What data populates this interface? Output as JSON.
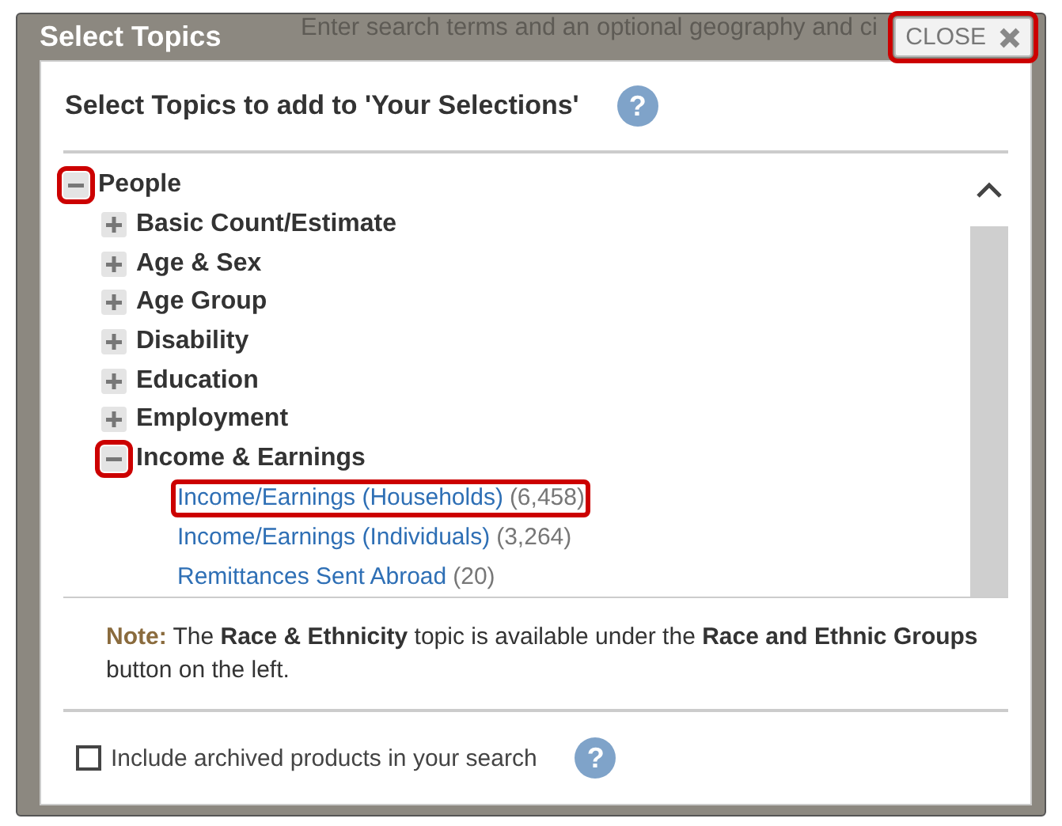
{
  "background": {
    "text": "Enter search terms and an optional geography and ci"
  },
  "dialog": {
    "title": "Select Topics",
    "close": {
      "label": "CLOSE",
      "highlighted": true
    },
    "heading": "Select Topics to add to 'Your Selections'",
    "heading_help": "?",
    "tree": [
      {
        "kind": "group",
        "label": "People",
        "expanded": true,
        "highlighted": true,
        "children": [
          {
            "kind": "group",
            "label": "Basic Count/Estimate",
            "expanded": false,
            "highlighted": false
          },
          {
            "kind": "group",
            "label": "Age & Sex",
            "expanded": false,
            "highlighted": false
          },
          {
            "kind": "group",
            "label": "Age Group",
            "expanded": false,
            "highlighted": false
          },
          {
            "kind": "group",
            "label": "Disability",
            "expanded": false,
            "highlighted": false
          },
          {
            "kind": "group",
            "label": "Education",
            "expanded": false,
            "highlighted": false
          },
          {
            "kind": "group",
            "label": "Employment",
            "expanded": false,
            "highlighted": false
          },
          {
            "kind": "group",
            "label": "Income & Earnings",
            "expanded": true,
            "highlighted": true,
            "children": [
              {
                "kind": "link",
                "label": "Income/Earnings (Households)",
                "count": "(6,458)",
                "highlighted": true
              },
              {
                "kind": "link",
                "label": "Income/Earnings (Individuals)",
                "count": "(3,264)",
                "highlighted": false
              },
              {
                "kind": "link",
                "label": "Remittances Sent Abroad",
                "count": "(20)",
                "highlighted": false
              }
            ]
          }
        ]
      }
    ],
    "note": {
      "label": "Note:",
      "text": "The **Race & Ethnicity** topic is available under the **Race and Ethnic Groups** button on the left."
    },
    "archive": {
      "label": "Include archived products in your search",
      "checked": false,
      "help": "?"
    }
  }
}
